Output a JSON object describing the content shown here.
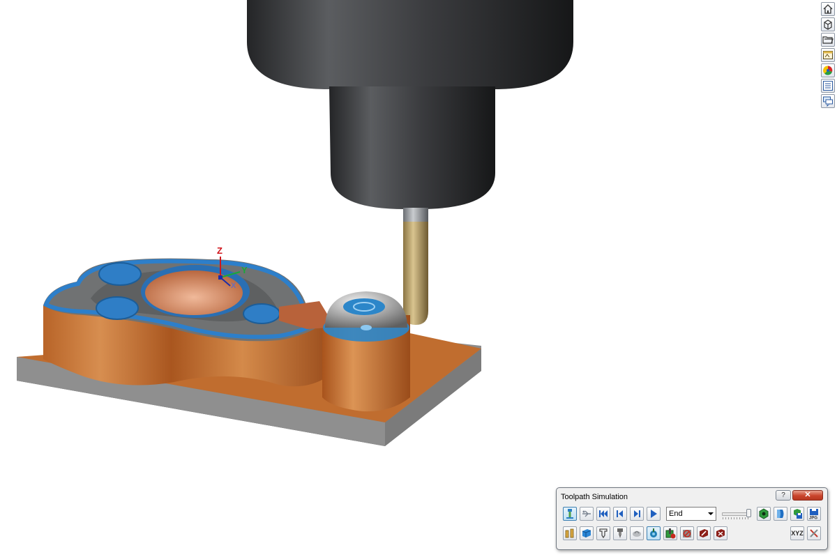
{
  "dialog": {
    "title": "Toolpath Simulation",
    "help_label": "?",
    "close_label": "✕",
    "end_select_value": "End",
    "xyz_label": "XYZ",
    "speed_level": 1.0
  },
  "axis_labels": {
    "z": "Z",
    "y": "Y",
    "x": "X"
  },
  "side_toolbar_icons": [
    "home-icon",
    "view-cube-icon",
    "folder-icon",
    "image-window-icon",
    "color-wheel-icon",
    "list-panel-icon",
    "chat-icon"
  ],
  "colors": {
    "part_copper": "#c8733a",
    "pocket_blue": "#2f7ec6",
    "base_plate": "#8d8d8d",
    "spindle": "#3a3b3d",
    "tool_gold": "#bfa56a",
    "accent_blue": "#2c86c9"
  }
}
